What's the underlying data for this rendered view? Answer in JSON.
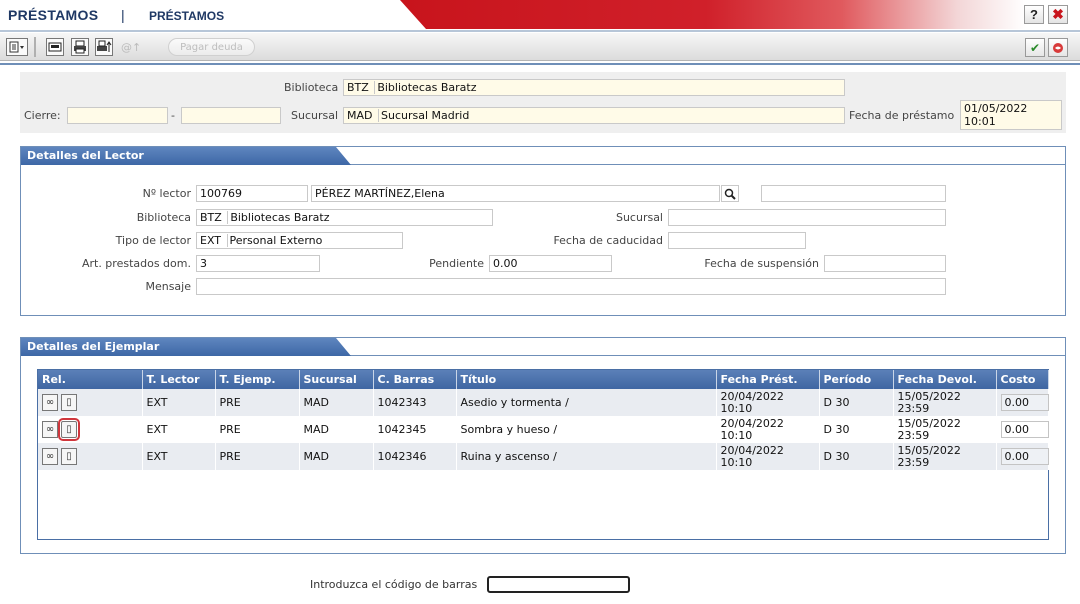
{
  "header": {
    "app_title": "PRÉSTAMOS",
    "separator": "|",
    "section_title": "PRÉSTAMOS",
    "help_label": "?",
    "close_label": "✖"
  },
  "toolbar": {
    "pay_debt_label": "Pagar deuda",
    "ghost_label": "@↑"
  },
  "filters": {
    "biblioteca_label": "Biblioteca",
    "biblioteca_code": "BTZ",
    "biblioteca_name": "Bibliotecas Baratz",
    "cierre_label": "Cierre:",
    "cierre_from": "",
    "cierre_sep": "-",
    "cierre_to": "",
    "sucursal_label": "Sucursal",
    "sucursal_code": "MAD",
    "sucursal_name": "Sucursal Madrid",
    "fecha_label": "Fecha de préstamo",
    "fecha_date": "01/05/2022",
    "fecha_time": "10:01"
  },
  "lector": {
    "section_title": "Detalles del Lector",
    "numero_label": "Nº lector",
    "numero_value": "100769",
    "nombre_value": "PÉREZ MARTÍNEZ,Elena",
    "extra_value": "",
    "biblioteca_label": "Biblioteca",
    "biblioteca_code": "BTZ",
    "biblioteca_name": "Bibliotecas Baratz",
    "sucursal_label": "Sucursal",
    "sucursal_value": "",
    "tipo_label": "Tipo de lector",
    "tipo_code": "EXT",
    "tipo_name": "Personal Externo",
    "caducidad_label": "Fecha de caducidad",
    "caducidad_value": "",
    "prestados_label": "Art. prestados dom.",
    "prestados_value": "3",
    "pendiente_label": "Pendiente",
    "pendiente_value": "0.00",
    "suspension_label": "Fecha de suspensión",
    "suspension_value": "",
    "mensaje_label": "Mensaje",
    "mensaje_value": ""
  },
  "ejemplar": {
    "section_title": "Detalles del Ejemplar",
    "columns": [
      "Rel.",
      "T. Lector",
      "T. Ejemp.",
      "Sucursal",
      "C. Barras",
      "Título",
      "Fecha Prést.",
      "Período",
      "Fecha Devol.",
      "Costo"
    ],
    "rows": [
      {
        "t_lector": "EXT",
        "t_ejemp": "PRE",
        "sucursal": "MAD",
        "barras": "1042343",
        "titulo": "Asedio y tormenta /",
        "fecha_prest_date": "20/04/2022",
        "fecha_prest_time": "10:10",
        "periodo": "D 30",
        "fecha_devol_date": "15/05/2022",
        "fecha_devol_time": "23:59",
        "costo": "0.00"
      },
      {
        "t_lector": "EXT",
        "t_ejemp": "PRE",
        "sucursal": "MAD",
        "barras": "1042345",
        "titulo": "Sombra y hueso /",
        "fecha_prest_date": "20/04/2022",
        "fecha_prest_time": "10:10",
        "periodo": "D 30",
        "fecha_devol_date": "15/05/2022",
        "fecha_devol_time": "23:59",
        "costo": "0.00"
      },
      {
        "t_lector": "EXT",
        "t_ejemp": "PRE",
        "sucursal": "MAD",
        "barras": "1042346",
        "titulo": "Ruina y ascenso /",
        "fecha_prest_date": "20/04/2022",
        "fecha_prest_time": "10:10",
        "periodo": "D 30",
        "fecha_devol_date": "15/05/2022",
        "fecha_devol_time": "23:59",
        "costo": "0.00"
      }
    ]
  },
  "barcode": {
    "label": "Introduzca el código de barras",
    "value": ""
  },
  "colors": {
    "header_red": "#c8141c",
    "panel_blue": "#4a6fa5",
    "title_navy": "#1f3864",
    "field_cream": "#fffbe8"
  }
}
